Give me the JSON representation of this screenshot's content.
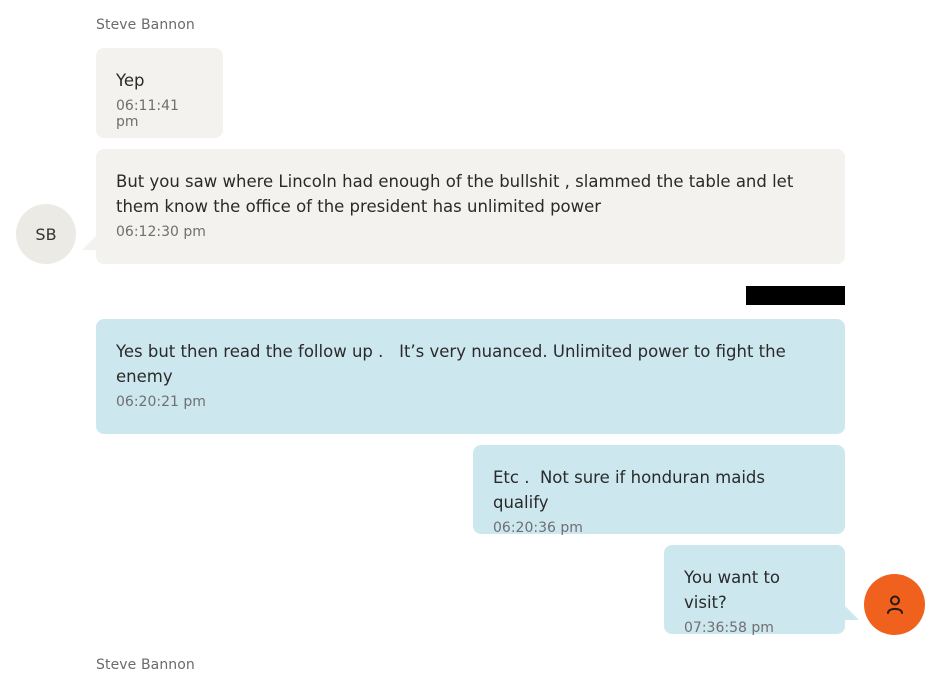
{
  "thread": {
    "sender_top": "Steve Bannon",
    "sender_bottom": "Steve Bannon",
    "contact_avatar_initials": "SB",
    "messages": [
      {
        "direction": "incoming",
        "text": "Yep",
        "time": "06:11:41 pm"
      },
      {
        "direction": "incoming",
        "text": "But you saw where Lincoln had enough of the bullshit , slammed the table and let them know the office of the president has unlimited power",
        "time": "06:12:30 pm"
      },
      {
        "direction": "outgoing",
        "text": "Yes but then read the follow up .   It’s very nuanced. Unlimited power to fight the enemy",
        "time": "06:20:21 pm"
      },
      {
        "direction": "outgoing",
        "text": "Etc .  Not sure if honduran maids qualify",
        "time": "06:20:36 pm"
      },
      {
        "direction": "outgoing",
        "text": "You want to visit?",
        "time": "07:36:58 pm"
      }
    ]
  },
  "colors": {
    "incoming_bubble": "#f3f2ee",
    "outgoing_bubble": "#cde7ef",
    "user_avatar": "#f0611d",
    "redaction": "#000000"
  },
  "icons": {
    "user_avatar_icon": "person-icon"
  }
}
